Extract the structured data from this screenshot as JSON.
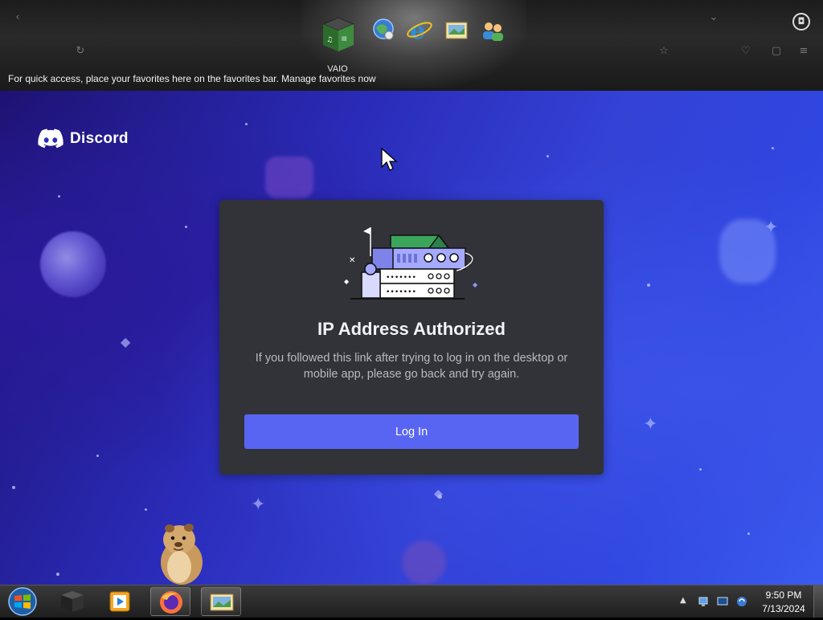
{
  "browser": {
    "quick_access_text": "For quick access, place your favorites here on the favorites bar. Manage favorites now"
  },
  "dock": {
    "icons": [
      "vaio-icon",
      "globe-icon",
      "internet-explorer-icon",
      "photo-icon",
      "users-icon"
    ],
    "active_label": "VAIO"
  },
  "discord": {
    "brand": "Discord",
    "card": {
      "title": "IP Address Authorized",
      "description": "If you followed this link after trying to log in on the desktop or mobile app, please go back and try again.",
      "button_label": "Log In"
    },
    "colors": {
      "card_bg": "#313338",
      "button": "#5865f2",
      "title": "#f2f3f5",
      "text": "#b5bac1"
    }
  },
  "taskbar": {
    "items": [
      "start-orb-icon",
      "vaio-box-icon",
      "media-player-icon",
      "firefox-icon",
      "photo-gallery-icon"
    ],
    "tray_icons": [
      "network-icon",
      "display-icon",
      "sync-icon"
    ],
    "clock": {
      "time": "9:50 PM",
      "date": "7/13/2024"
    }
  }
}
